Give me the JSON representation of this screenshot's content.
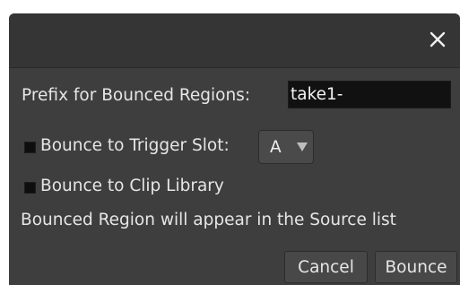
{
  "dialog": {
    "close_icon": "close-icon"
  },
  "prefix": {
    "label": "Prefix for Bounced Regions:",
    "value": "take1-"
  },
  "options": {
    "trigger_slot_label": "Bounce to Trigger Slot:",
    "trigger_slot_checked": false,
    "trigger_slot_value": "A",
    "clip_library_label": "Bounce to Clip Library",
    "clip_library_checked": false
  },
  "info": {
    "text": "Bounced Region will appear in the Source list"
  },
  "buttons": {
    "cancel": "Cancel",
    "bounce": "Bounce"
  }
}
